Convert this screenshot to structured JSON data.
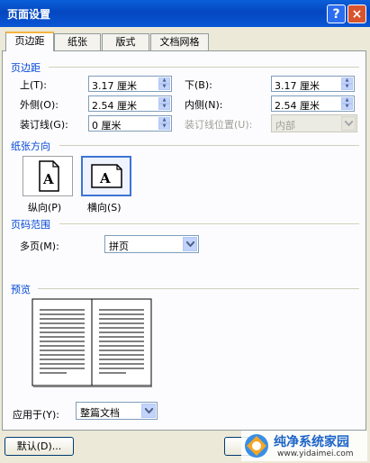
{
  "window": {
    "title": "页面设置",
    "help_glyph": "?",
    "close_glyph": "×"
  },
  "tabs": [
    {
      "label": "页边距",
      "active": true
    },
    {
      "label": "纸张",
      "active": false
    },
    {
      "label": "版式",
      "active": false
    },
    {
      "label": "文档网格",
      "active": false
    }
  ],
  "margins": {
    "section_label": "页边距",
    "top": {
      "label": "上(T):",
      "value": "3.17 厘米"
    },
    "bottom": {
      "label": "下(B):",
      "value": "3.17 厘米"
    },
    "outside": {
      "label": "外侧(O):",
      "value": "2.54 厘米"
    },
    "inside": {
      "label": "内侧(N):",
      "value": "2.54 厘米"
    },
    "gutter": {
      "label": "装订线(G):",
      "value": "0 厘米"
    },
    "gutter_position": {
      "label": "装订线位置(U):",
      "value": "内部",
      "disabled": true
    }
  },
  "orientation": {
    "section_label": "纸张方向",
    "portrait_label": "纵向(P)",
    "landscape_label": "横向(S)",
    "icon_letter": "A",
    "selected": "landscape"
  },
  "pages": {
    "section_label": "页码范围",
    "multiple_label": "多页(M):",
    "multiple_value": "拼页"
  },
  "preview": {
    "section_label": "预览"
  },
  "apply": {
    "label": "应用于(Y):",
    "value": "整篇文档"
  },
  "footer": {
    "default_button": "默认(D)...",
    "watermark_text": "纯净系统家园",
    "watermark_url": "www.yidaimei.com"
  },
  "colors": {
    "titlebar": "#0a56d5",
    "section_label": "#0046d5",
    "dialog_bg": "#ece9d8",
    "panel_bg": "#fcfcfe"
  }
}
